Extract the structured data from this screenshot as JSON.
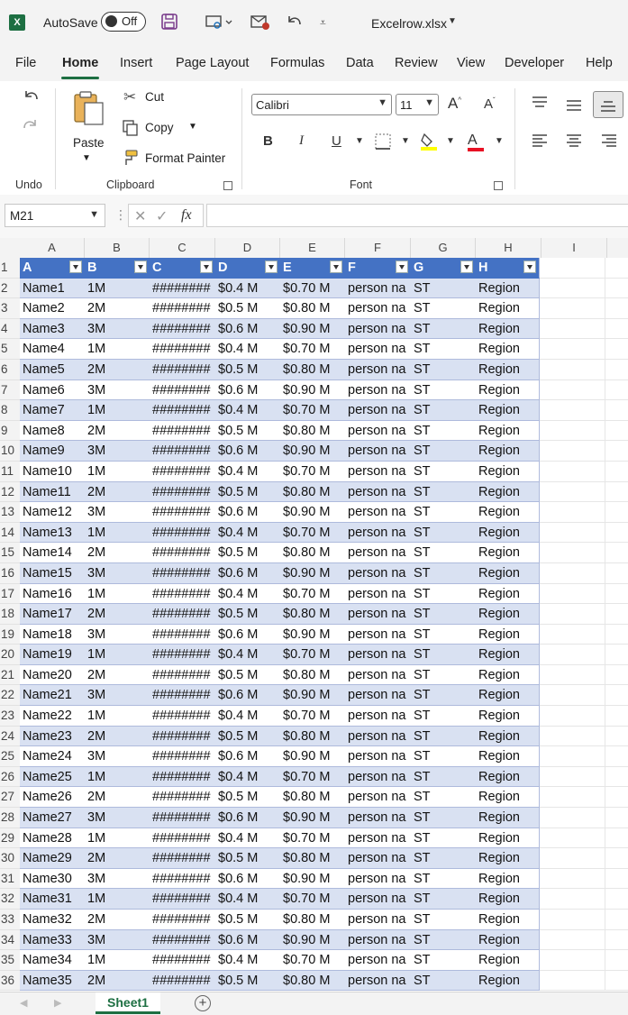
{
  "titlebar": {
    "logo": "X",
    "autosave_label": "AutoSave",
    "autosave_state": "Off",
    "filename": "Excelrow.xlsx",
    "icons": [
      "save-icon",
      "touch-mode-icon",
      "send-icon",
      "undo-icon",
      "customize-icon"
    ]
  },
  "menu": {
    "tabs": [
      "File",
      "Home",
      "Insert",
      "Page Layout",
      "Formulas",
      "Data",
      "Review",
      "View",
      "Developer",
      "Help"
    ],
    "active": "Home"
  },
  "ribbon": {
    "undo_group": "Undo",
    "clipboard_group": "Clipboard",
    "font_group": "Font",
    "paste": "Paste",
    "cut": "Cut",
    "copy": "Copy",
    "format_painter": "Format Painter",
    "font_name": "Calibri",
    "font_size": "11",
    "bold": "B",
    "italic": "I",
    "underline": "U",
    "font_color_letter": "A"
  },
  "formula_bar": {
    "name_box": "M21",
    "fx": "fx",
    "formula": ""
  },
  "grid": {
    "column_letters": [
      "A",
      "B",
      "C",
      "D",
      "E",
      "F",
      "G",
      "H",
      "I"
    ],
    "header_row": [
      "A",
      "B",
      "C",
      "D",
      "E",
      "F",
      "G",
      "H"
    ],
    "rows": [
      [
        "Name1",
        "1M",
        "########",
        "$0.4 M",
        "$0.70 M",
        "person na",
        "ST",
        "Region"
      ],
      [
        "Name2",
        "2M",
        "########",
        "$0.5 M",
        "$0.80 M",
        "person na",
        "ST",
        "Region"
      ],
      [
        "Name3",
        "3M",
        "########",
        "$0.6 M",
        "$0.90 M",
        "person na",
        "ST",
        "Region"
      ],
      [
        "Name4",
        "1M",
        "########",
        "$0.4 M",
        "$0.70 M",
        "person na",
        "ST",
        "Region"
      ],
      [
        "Name5",
        "2M",
        "########",
        "$0.5 M",
        "$0.80 M",
        "person na",
        "ST",
        "Region"
      ],
      [
        "Name6",
        "3M",
        "########",
        "$0.6 M",
        "$0.90 M",
        "person na",
        "ST",
        "Region"
      ],
      [
        "Name7",
        "1M",
        "########",
        "$0.4 M",
        "$0.70 M",
        "person na",
        "ST",
        "Region"
      ],
      [
        "Name8",
        "2M",
        "########",
        "$0.5 M",
        "$0.80 M",
        "person na",
        "ST",
        "Region"
      ],
      [
        "Name9",
        "3M",
        "########",
        "$0.6 M",
        "$0.90 M",
        "person na",
        "ST",
        "Region"
      ],
      [
        "Name10",
        "1M",
        "########",
        "$0.4 M",
        "$0.70 M",
        "person na",
        "ST",
        "Region"
      ],
      [
        "Name11",
        "2M",
        "########",
        "$0.5 M",
        "$0.80 M",
        "person na",
        "ST",
        "Region"
      ],
      [
        "Name12",
        "3M",
        "########",
        "$0.6 M",
        "$0.90 M",
        "person na",
        "ST",
        "Region"
      ],
      [
        "Name13",
        "1M",
        "########",
        "$0.4 M",
        "$0.70 M",
        "person na",
        "ST",
        "Region"
      ],
      [
        "Name14",
        "2M",
        "########",
        "$0.5 M",
        "$0.80 M",
        "person na",
        "ST",
        "Region"
      ],
      [
        "Name15",
        "3M",
        "########",
        "$0.6 M",
        "$0.90 M",
        "person na",
        "ST",
        "Region"
      ],
      [
        "Name16",
        "1M",
        "########",
        "$0.4 M",
        "$0.70 M",
        "person na",
        "ST",
        "Region"
      ],
      [
        "Name17",
        "2M",
        "########",
        "$0.5 M",
        "$0.80 M",
        "person na",
        "ST",
        "Region"
      ],
      [
        "Name18",
        "3M",
        "########",
        "$0.6 M",
        "$0.90 M",
        "person na",
        "ST",
        "Region"
      ],
      [
        "Name19",
        "1M",
        "########",
        "$0.4 M",
        "$0.70 M",
        "person na",
        "ST",
        "Region"
      ],
      [
        "Name20",
        "2M",
        "########",
        "$0.5 M",
        "$0.80 M",
        "person na",
        "ST",
        "Region"
      ],
      [
        "Name21",
        "3M",
        "########",
        "$0.6 M",
        "$0.90 M",
        "person na",
        "ST",
        "Region"
      ],
      [
        "Name22",
        "1M",
        "########",
        "$0.4 M",
        "$0.70 M",
        "person na",
        "ST",
        "Region"
      ],
      [
        "Name23",
        "2M",
        "########",
        "$0.5 M",
        "$0.80 M",
        "person na",
        "ST",
        "Region"
      ],
      [
        "Name24",
        "3M",
        "########",
        "$0.6 M",
        "$0.90 M",
        "person na",
        "ST",
        "Region"
      ],
      [
        "Name25",
        "1M",
        "########",
        "$0.4 M",
        "$0.70 M",
        "person na",
        "ST",
        "Region"
      ],
      [
        "Name26",
        "2M",
        "########",
        "$0.5 M",
        "$0.80 M",
        "person na",
        "ST",
        "Region"
      ],
      [
        "Name27",
        "3M",
        "########",
        "$0.6 M",
        "$0.90 M",
        "person na",
        "ST",
        "Region"
      ],
      [
        "Name28",
        "1M",
        "########",
        "$0.4 M",
        "$0.70 M",
        "person na",
        "ST",
        "Region"
      ],
      [
        "Name29",
        "2M",
        "########",
        "$0.5 M",
        "$0.80 M",
        "person na",
        "ST",
        "Region"
      ],
      [
        "Name30",
        "3M",
        "########",
        "$0.6 M",
        "$0.90 M",
        "person na",
        "ST",
        "Region"
      ],
      [
        "Name31",
        "1M",
        "########",
        "$0.4 M",
        "$0.70 M",
        "person na",
        "ST",
        "Region"
      ],
      [
        "Name32",
        "2M",
        "########",
        "$0.5 M",
        "$0.80 M",
        "person na",
        "ST",
        "Region"
      ],
      [
        "Name33",
        "3M",
        "########",
        "$0.6 M",
        "$0.90 M",
        "person na",
        "ST",
        "Region"
      ],
      [
        "Name34",
        "1M",
        "########",
        "$0.4 M",
        "$0.70 M",
        "person na",
        "ST",
        "Region"
      ],
      [
        "Name35",
        "2M",
        "########",
        "$0.5 M",
        "$0.80 M",
        "person na",
        "ST",
        "Region"
      ]
    ]
  },
  "sheets": {
    "tabs": [
      "Sheet1"
    ],
    "add_label": "+"
  },
  "colors": {
    "table_header": "#4472c4",
    "table_band": "#d9e1f2",
    "excel_green": "#1d6f42"
  }
}
